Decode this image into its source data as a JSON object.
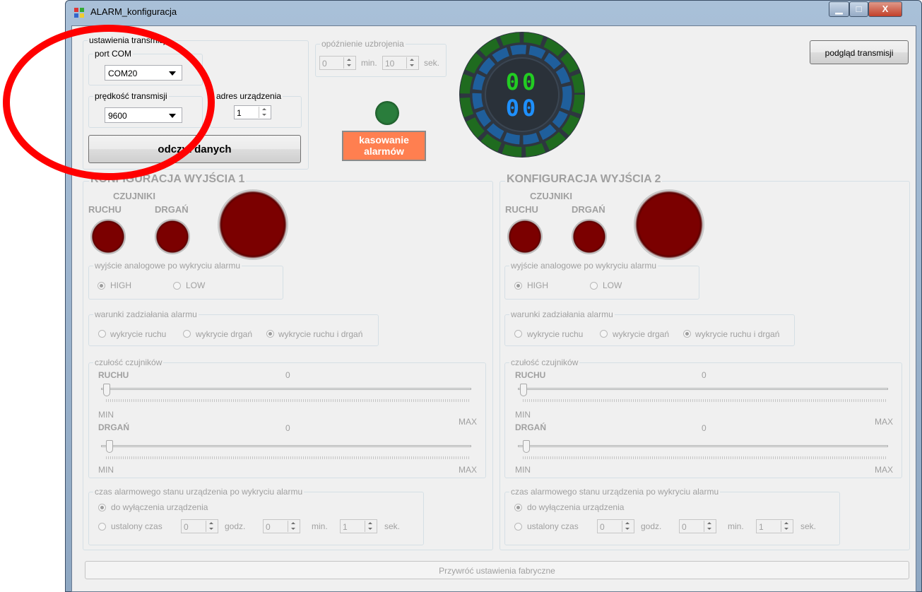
{
  "window": {
    "title": "ALARM_konfiguracja",
    "min_glyph": "▁",
    "max_glyph": "□",
    "close_glyph": "X"
  },
  "transmisja": {
    "group_label": "ustawienia transmisji",
    "port_label": "port COM",
    "port_value": "COM20",
    "speed_label": "prędkość transmisji",
    "speed_value": "9600",
    "address_label": "adres urządzenia",
    "address_value": "1",
    "read_button": "odczyt danych"
  },
  "opoznienie": {
    "label": "opóźnienie uzbrojenia",
    "min_value": "0",
    "min_unit": "min.",
    "sec_value": "10",
    "sec_unit": "sek."
  },
  "status_led_color": "#2d7a3c",
  "reset_button": "kasowanie alarmów",
  "reset_button_color": "#ff7f50",
  "display": {
    "top_digits": "00",
    "bottom_digits": "00",
    "top_color": "#22cc22",
    "bottom_color": "#1e90ff"
  },
  "preview_button": "podgląd transmisji",
  "outputs": [
    {
      "title": "KONFIGURACJA WYJŚCIA 1",
      "sensors_label": "CZUJNIKI",
      "motion_label": "RUCHU",
      "vibration_label": "DRGAŃ",
      "analog_group": "wyjście analogowe po wykryciu alarmu",
      "high": "HIGH",
      "low": "LOW",
      "conditions_group": "warunki zadziałania alarmu",
      "cond_motion": "wykrycie ruchu",
      "cond_vibration": "wykrycie drgań",
      "cond_both": "wykrycie ruchu i drgań",
      "sensitivity_group": "czułość czujników",
      "motion_sens_label": "RUCHU",
      "motion_sens_value": "0",
      "vib_sens_label": "DRGAŃ",
      "vib_sens_value": "0",
      "min": "MIN",
      "max": "MAX",
      "time_group": "czas alarmowego stanu urządzenia po wykryciu alarmu",
      "until_off": "do wyłączenia urządzenia",
      "fixed_time": "ustalony czas",
      "hours_value": "0",
      "hours_unit": "godz.",
      "minutes_value": "0",
      "minutes_unit": "min.",
      "seconds_value": "1",
      "seconds_unit": "sek."
    },
    {
      "title": "KONFIGURACJA WYJŚCIA 2",
      "sensors_label": "CZUJNIKI",
      "motion_label": "RUCHU",
      "vibration_label": "DRGAŃ",
      "analog_group": "wyjście analogowe po wykryciu alarmu",
      "high": "HIGH",
      "low": "LOW",
      "conditions_group": "warunki zadziałania alarmu",
      "cond_motion": "wykrycie ruchu",
      "cond_vibration": "wykrycie drgań",
      "cond_both": "wykrycie ruchu i drgań",
      "sensitivity_group": "czułość czujników",
      "motion_sens_label": "RUCHU",
      "motion_sens_value": "0",
      "vib_sens_label": "DRGAŃ",
      "vib_sens_value": "0",
      "min": "MIN",
      "max": "MAX",
      "time_group": "czas alarmowego stanu urządzenia po wykryciu alarmu",
      "until_off": "do wyłączenia urządzenia",
      "fixed_time": "ustalony czas",
      "hours_value": "0",
      "hours_unit": "godz.",
      "minutes_value": "0",
      "minutes_unit": "min.",
      "seconds_value": "1",
      "seconds_unit": "sek."
    }
  ],
  "restore_button": "Przywróć ustawienia fabryczne",
  "annotation_color": "#ff0000"
}
